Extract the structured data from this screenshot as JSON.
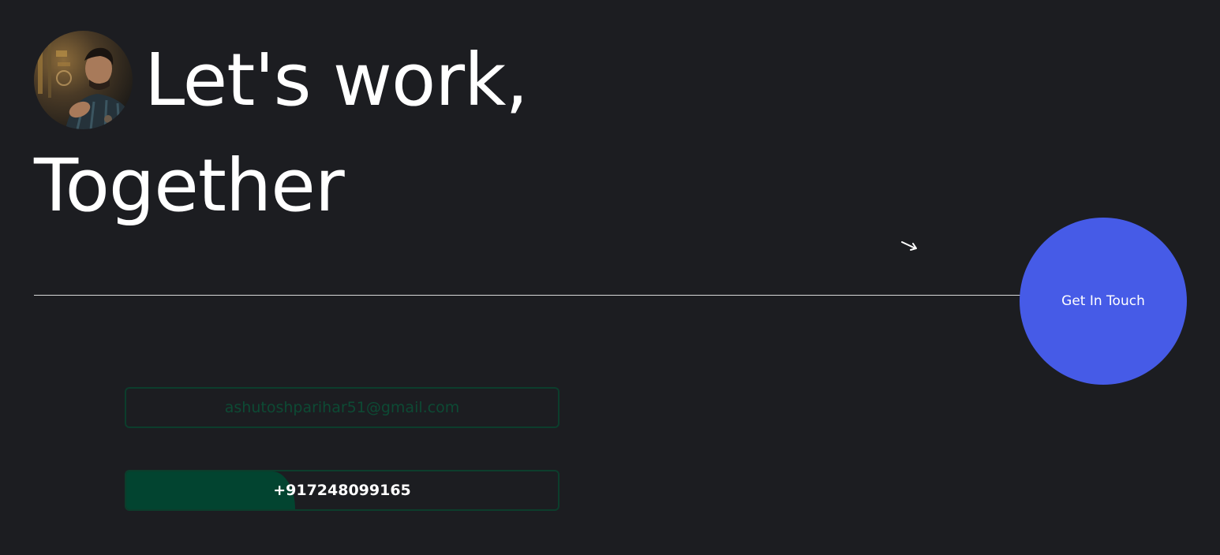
{
  "hero": {
    "headline_line1": "Let's work,",
    "headline_line2": "Together"
  },
  "cta": {
    "label": "Get In Touch",
    "color": "#465be7"
  },
  "contacts": {
    "email": "ashutoshparihar51@gmail.com",
    "phone": "+917248099165"
  },
  "icons": {
    "avatar": "profile-photo",
    "arrow": "arrow-down-right-icon"
  },
  "colors": {
    "background": "#1c1d21",
    "accent_green": "#024430",
    "text": "#ffffff"
  }
}
